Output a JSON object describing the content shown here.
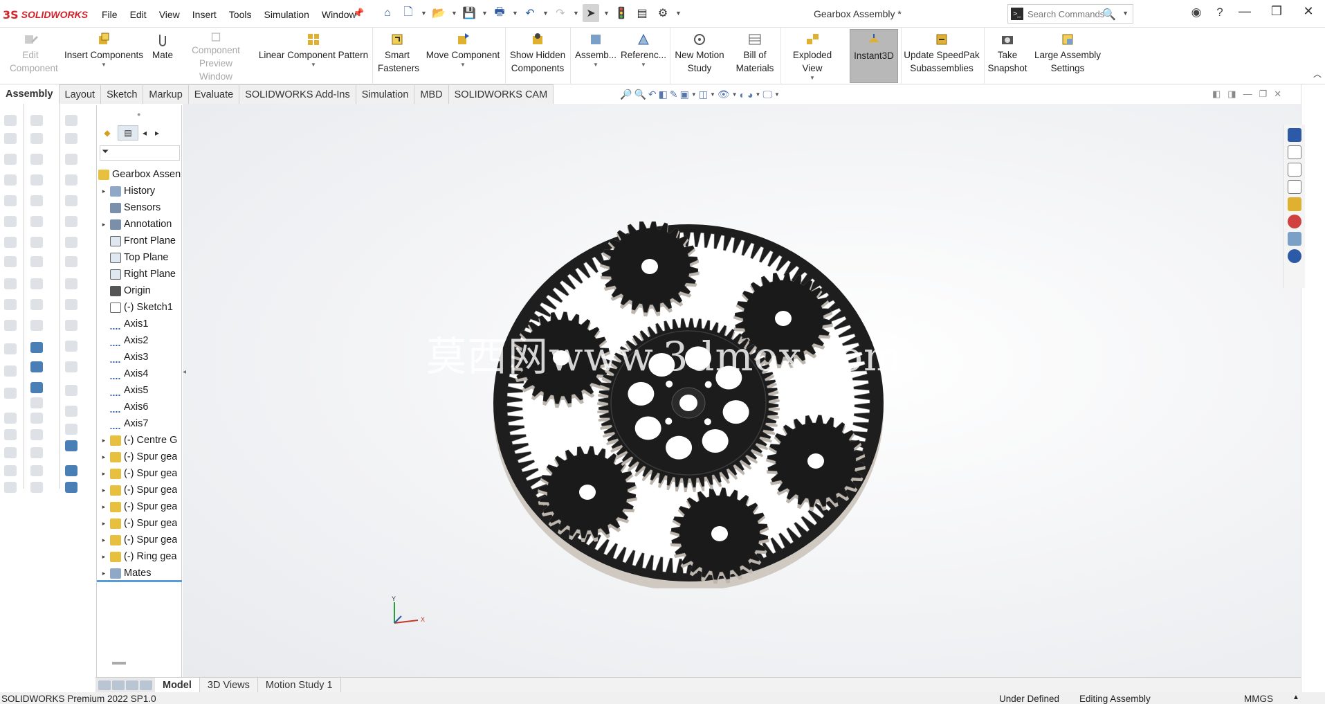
{
  "app": {
    "brand": "SOLIDWORKS",
    "document_title": "Gearbox Assembly *"
  },
  "menu": [
    "File",
    "Edit",
    "View",
    "Insert",
    "Tools",
    "Simulation",
    "Window"
  ],
  "search": {
    "placeholder": "Search Commands"
  },
  "ribbon": [
    {
      "label": "Edit Component",
      "enabled": false
    },
    {
      "label": "Insert Components",
      "enabled": true
    },
    {
      "label": "Mate",
      "enabled": true
    },
    {
      "label": "Component Preview Window",
      "enabled": false
    },
    {
      "label": "Linear Component Pattern",
      "enabled": true
    },
    {
      "label": "Smart Fasteners",
      "enabled": true
    },
    {
      "label": "Move Component",
      "enabled": true
    },
    {
      "label": "Show Hidden Components",
      "enabled": true
    },
    {
      "label": "Assemb...",
      "enabled": true
    },
    {
      "label": "Referenc...",
      "enabled": true
    },
    {
      "label": "New Motion Study",
      "enabled": true
    },
    {
      "label": "Bill of Materials",
      "enabled": true
    },
    {
      "label": "Exploded View",
      "enabled": true
    },
    {
      "label": "Instant3D",
      "enabled": true,
      "active": true
    },
    {
      "label": "Update SpeedPak Subassemblies",
      "enabled": true
    },
    {
      "label": "Take Snapshot",
      "enabled": true
    },
    {
      "label": "Large Assembly Settings",
      "enabled": true
    }
  ],
  "tabs": [
    "Assembly",
    "Layout",
    "Sketch",
    "Markup",
    "Evaluate",
    "SOLIDWORKS Add-Ins",
    "Simulation",
    "MBD",
    "SOLIDWORKS CAM"
  ],
  "active_tab": "Assembly",
  "feature_tree": {
    "root": "Gearbox Assen",
    "items": [
      {
        "label": "History",
        "expandable": true,
        "icon": "history-icon"
      },
      {
        "label": "Sensors",
        "expandable": false,
        "icon": "sensor-icon"
      },
      {
        "label": "Annotation",
        "expandable": true,
        "icon": "annotation-icon"
      },
      {
        "label": "Front Plane",
        "expandable": false,
        "icon": "plane-icon"
      },
      {
        "label": "Top Plane",
        "expandable": false,
        "icon": "plane-icon"
      },
      {
        "label": "Right Plane",
        "expandable": false,
        "icon": "plane-icon"
      },
      {
        "label": "Origin",
        "expandable": false,
        "icon": "origin-icon"
      },
      {
        "label": "(-) Sketch1",
        "expandable": false,
        "icon": "sketch-icon"
      },
      {
        "label": "Axis1",
        "expandable": false,
        "icon": "axis-icon"
      },
      {
        "label": "Axis2",
        "expandable": false,
        "icon": "axis-icon"
      },
      {
        "label": "Axis3",
        "expandable": false,
        "icon": "axis-icon"
      },
      {
        "label": "Axis4",
        "expandable": false,
        "icon": "axis-icon"
      },
      {
        "label": "Axis5",
        "expandable": false,
        "icon": "axis-icon"
      },
      {
        "label": "Axis6",
        "expandable": false,
        "icon": "axis-icon"
      },
      {
        "label": "Axis7",
        "expandable": false,
        "icon": "axis-icon"
      },
      {
        "label": "(-) Centre G",
        "expandable": true,
        "icon": "part-icon"
      },
      {
        "label": "(-) Spur gea",
        "expandable": true,
        "icon": "part-icon"
      },
      {
        "label": "(-) Spur gea",
        "expandable": true,
        "icon": "part-icon"
      },
      {
        "label": "(-) Spur gea",
        "expandable": true,
        "icon": "part-icon"
      },
      {
        "label": "(-) Spur gea",
        "expandable": true,
        "icon": "part-icon"
      },
      {
        "label": "(-) Spur gea",
        "expandable": true,
        "icon": "part-icon"
      },
      {
        "label": "(-) Spur gea",
        "expandable": true,
        "icon": "part-icon"
      },
      {
        "label": "(-) Ring gea",
        "expandable": true,
        "icon": "part-icon"
      },
      {
        "label": "Mates",
        "expandable": true,
        "icon": "mates-icon"
      }
    ]
  },
  "watermark": "莫西网www.3dmox.com",
  "triad": {
    "y": "Y",
    "x": "X"
  },
  "bottom_tabs": [
    "Model",
    "3D Views",
    "Motion Study 1"
  ],
  "active_bottom_tab": "Model",
  "status": {
    "version": "SOLIDWORKS Premium 2022 SP1.0",
    "state": "Under Defined",
    "mode": "Editing Assembly",
    "units": "MMGS"
  },
  "colors": {
    "accent": "#d2232a",
    "active_button": "#b8b8b8",
    "tree_icon": "#e8c040"
  }
}
